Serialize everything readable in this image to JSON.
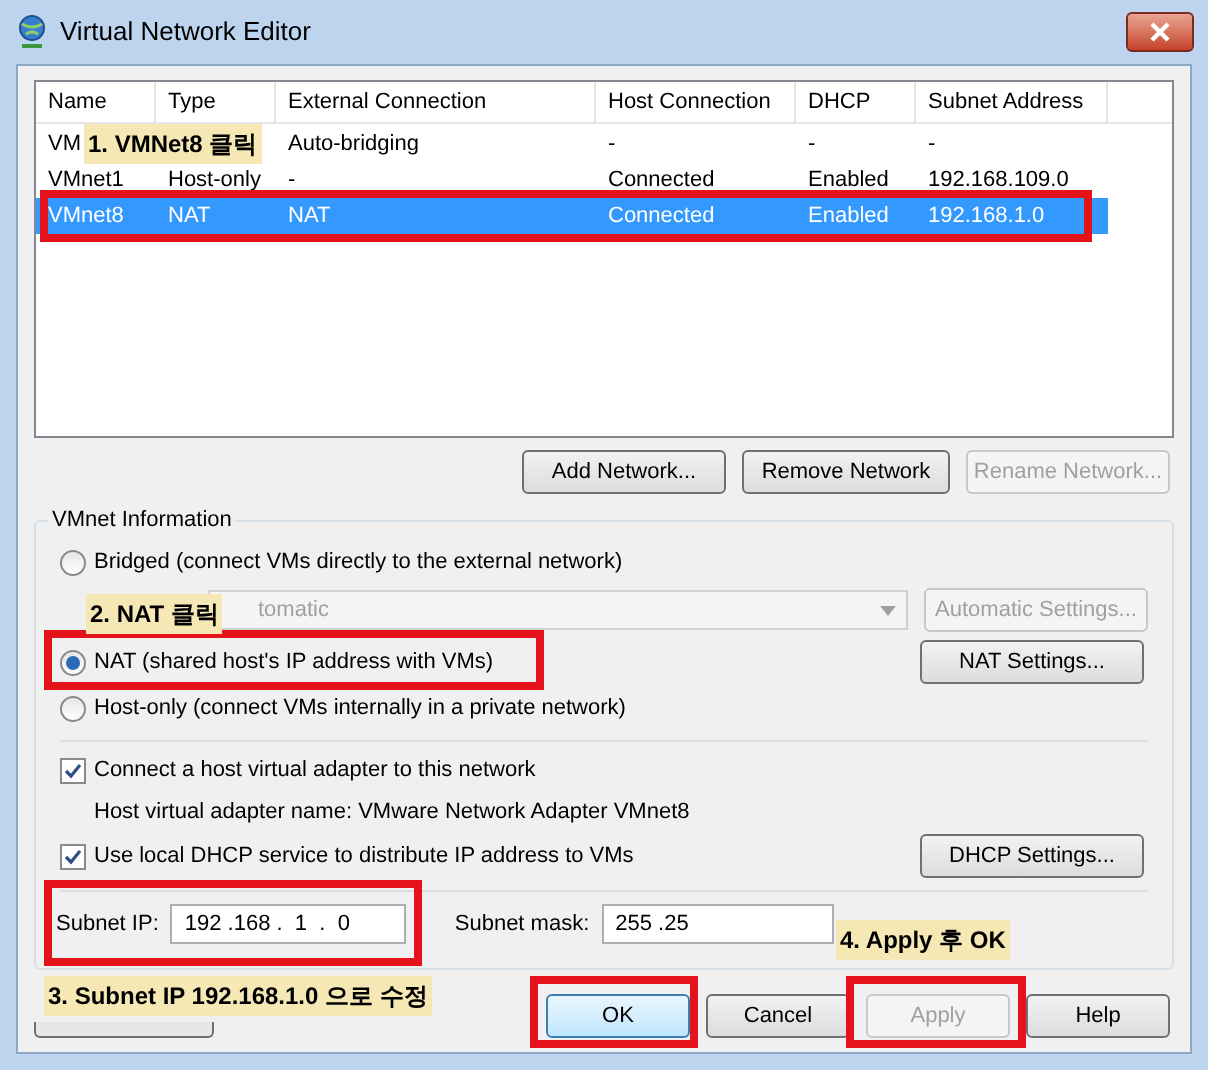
{
  "window": {
    "title": "Virtual Network Editor"
  },
  "list": {
    "columns": [
      "Name",
      "Type",
      "External Connection",
      "Host Connection",
      "DHCP",
      "Subnet Address"
    ],
    "rows": [
      {
        "name": "VM",
        "external": "Auto-bridging",
        "host": "-",
        "dhcp": "-",
        "subnet": "-",
        "selected": false
      },
      {
        "name": "VMnet1",
        "type": "Host-only",
        "external": "-",
        "host": "Connected",
        "dhcp": "Enabled",
        "subnet": "192.168.109.0",
        "selected": false
      },
      {
        "name": "VMnet8",
        "type": "NAT",
        "external": "NAT",
        "host": "Connected",
        "dhcp": "Enabled",
        "subnet": "192.168.1.0",
        "selected": true
      }
    ]
  },
  "list_buttons": [
    {
      "label": "Add Network...",
      "disabled": false
    },
    {
      "label": "Remove Network",
      "disabled": false
    },
    {
      "label": "Rename Network...",
      "disabled": true
    }
  ],
  "vmnet_info": {
    "title": "VMnet Information",
    "bridged": {
      "label": "Bridged (connect VMs directly to the external network)",
      "selected": false
    },
    "bridge_dropdown": {
      "value": "tomatic",
      "disabled": true
    },
    "automatic_settings": {
      "label": "Automatic Settings...",
      "disabled": true
    },
    "nat": {
      "label": "NAT (shared host's IP address with VMs)",
      "selected": true
    },
    "nat_settings": {
      "label": "NAT Settings...",
      "disabled": false
    },
    "host_only": {
      "label": "Host-only (connect VMs internally in a private network)",
      "selected": false
    },
    "connect_adapter": {
      "label": "Connect a host virtual adapter to this network",
      "checked": true
    },
    "adapter_name": "Host virtual adapter name: VMware Network Adapter VMnet8",
    "use_dhcp": {
      "label": "Use local DHCP service to distribute IP address to VMs",
      "checked": true
    },
    "dhcp_settings": {
      "label": "DHCP Settings...",
      "disabled": false
    },
    "subnet_ip": {
      "label": "Subnet IP:",
      "value": "192 .168 .  1  .  0"
    },
    "subnet_mask": {
      "label": "Subnet mask:",
      "value": "255 .25"
    }
  },
  "footer_buttons": [
    {
      "label": "OK",
      "disabled": false
    },
    {
      "label": "Cancel",
      "disabled": false
    },
    {
      "label": "Apply",
      "disabled": true
    },
    {
      "label": "Help",
      "disabled": false
    }
  ],
  "annotations": [
    "1. VMNet8 클릭",
    "2. NAT 클릭",
    "3. Subnet IP 192.168.1.0 으로 수정",
    "4. Apply 후 OK"
  ]
}
